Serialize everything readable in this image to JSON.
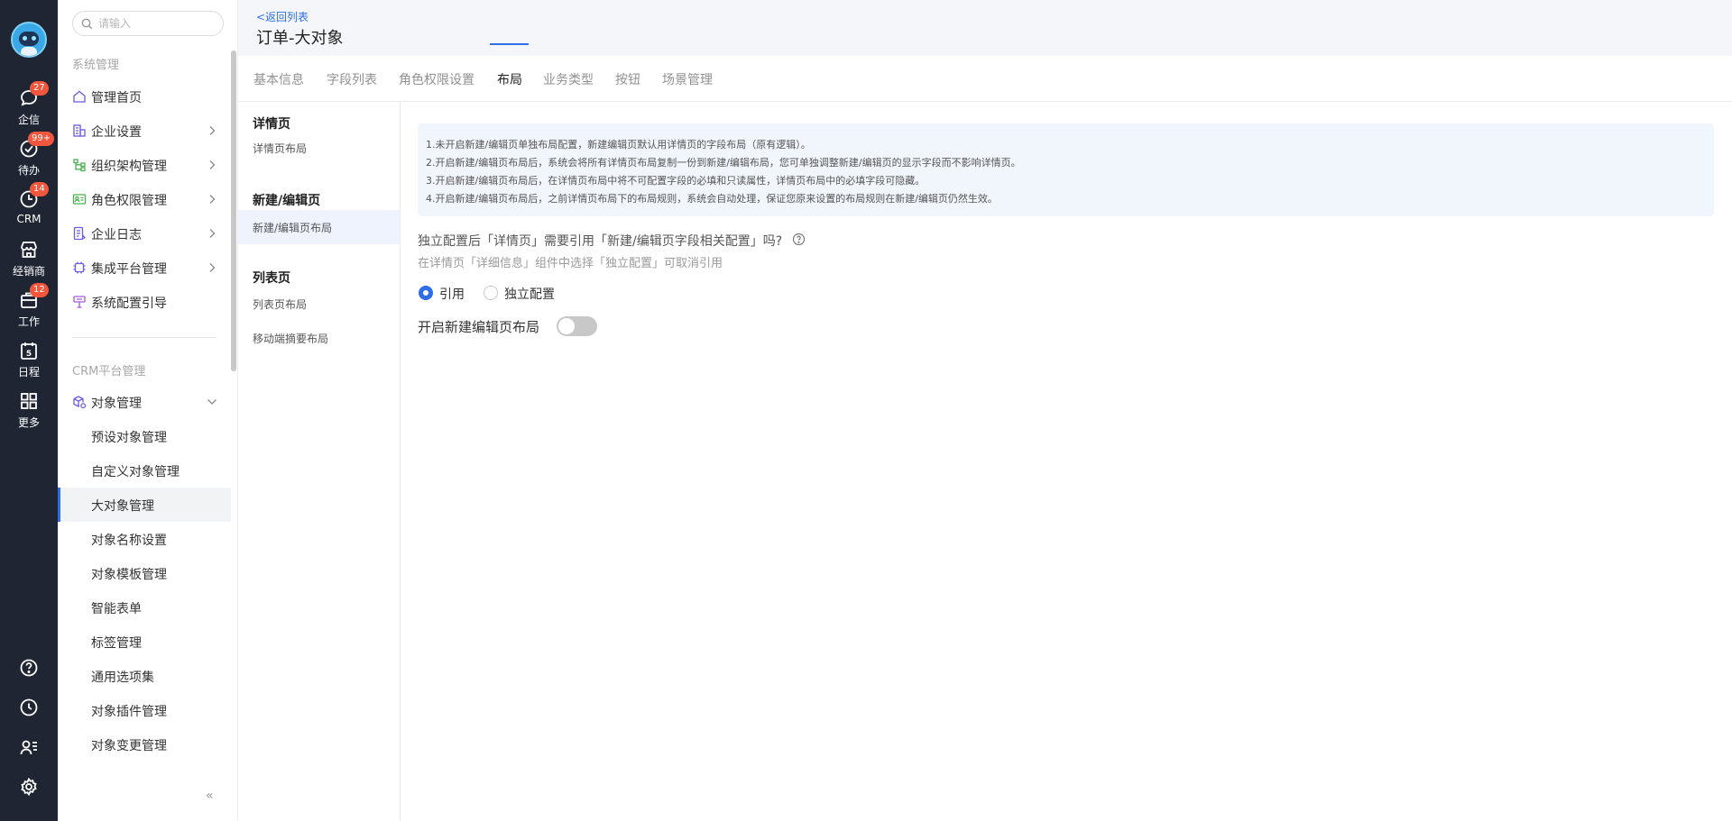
{
  "rail": {
    "items": [
      {
        "label": "企信",
        "badge": "27",
        "icon": "chat-icon"
      },
      {
        "label": "待办",
        "badge": "99+",
        "icon": "check-circle-icon"
      },
      {
        "label": "CRM",
        "badge": "14",
        "icon": "crm-icon"
      },
      {
        "label": "经销商",
        "badge": "",
        "icon": "store-icon"
      },
      {
        "label": "工作",
        "badge": "12",
        "icon": "briefcase-icon"
      },
      {
        "label": "日程",
        "badge": "",
        "icon": "calendar-icon",
        "day": "5"
      },
      {
        "label": "更多",
        "badge": "",
        "icon": "grid-icon"
      }
    ],
    "bottom_icons": [
      "help-icon",
      "clock-icon",
      "user-list-icon",
      "settings-icon"
    ]
  },
  "sidebar": {
    "search_placeholder": "请输入",
    "group_system": "系统管理",
    "items": [
      {
        "label": "管理首页",
        "icon": "home-icon"
      },
      {
        "label": "企业设置",
        "icon": "building-icon"
      },
      {
        "label": "组织架构管理",
        "icon": "org-icon"
      },
      {
        "label": "角色权限管理",
        "icon": "id-card-icon"
      },
      {
        "label": "企业日志",
        "icon": "log-icon"
      },
      {
        "label": "集成平台管理",
        "icon": "chip-icon"
      },
      {
        "label": "系统配置引导",
        "icon": "guide-icon"
      }
    ],
    "group_crm": "CRM平台管理",
    "object_management": "对象管理",
    "sub_items": [
      "预设对象管理",
      "自定义对象管理",
      "大对象管理",
      "对象名称设置",
      "对象模板管理",
      "智能表单",
      "标签管理",
      "通用选项集",
      "对象插件管理",
      "对象变更管理"
    ],
    "active_sub": "大对象管理",
    "collapse": "«"
  },
  "header": {
    "back": "<返回列表",
    "title": "订单-大对象"
  },
  "tabs": [
    {
      "label": "基本信息"
    },
    {
      "label": "字段列表"
    },
    {
      "label": "角色权限设置"
    },
    {
      "label": "布局"
    },
    {
      "label": "业务类型"
    },
    {
      "label": "按钮"
    },
    {
      "label": "场景管理"
    }
  ],
  "active_tab": "布局",
  "layout_nav": {
    "detail_title": "详情页",
    "detail_item": "详情页布局",
    "edit_title": "新建/编辑页",
    "edit_item": "新建/编辑页布局",
    "list_title": "列表页",
    "list_items": [
      "列表页布局",
      "移动端摘要布局"
    ]
  },
  "notice": [
    "1.未开启新建/编辑页单独布局配置，新建编辑页默认用详情页的字段布局（原有逻辑）。",
    "2.开启新建/编辑页布局后，系统会将所有详情页布局复制一份到新建/编辑布局，您可单独调整新建/编辑页的显示字段而不影响详情页。",
    "3.开启新建/编辑页布局后，在详情页布局中将不可配置字段的必填和只读属性，详情页布局中的必填字段可隐藏。",
    "4.开启新建/编辑页布局后，之前详情页布局下的布局规则，系统会自动处理，保证您原来设置的布局规则在新建/编辑页仍然生效。"
  ],
  "question": "独立配置后「详情页」需要引用「新建/编辑页字段相关配置」吗?",
  "hint": "在详情页「详细信息」组件中选择「独立配置」可取消引用",
  "radio": {
    "options": [
      "引用",
      "独立配置"
    ],
    "selected": "引用"
  },
  "toggle": {
    "label": "开启新建编辑页布局",
    "on": false
  },
  "colors": {
    "accent": "#2f6ee8",
    "rail_bg": "#1f2533",
    "badge": "#f2563d"
  }
}
